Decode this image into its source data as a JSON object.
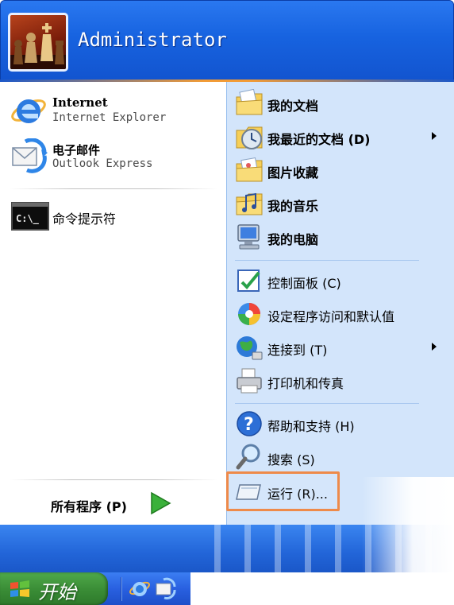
{
  "user": {
    "name": "Administrator",
    "avatar_icon": "chess-pieces-avatar"
  },
  "pinned": [
    {
      "title": "Internet",
      "subtitle": "Internet Explorer",
      "icon": "internet-explorer-icon"
    },
    {
      "title": "电子邮件",
      "subtitle": "Outlook Express",
      "icon": "outlook-express-icon"
    }
  ],
  "recent": [
    {
      "label": "命令提示符",
      "icon": "command-prompt-icon",
      "icon_text": "C:\\_"
    }
  ],
  "all_programs": {
    "label": "所有程序 (P)",
    "icon": "green-arrow-icon"
  },
  "places": [
    {
      "label": "我的文档",
      "bold": true,
      "icon": "my-documents-icon",
      "submenu": false
    },
    {
      "label": "我最近的文档 (D)",
      "bold": true,
      "icon": "recent-documents-icon",
      "submenu": true
    },
    {
      "label": "图片收藏",
      "bold": true,
      "icon": "my-pictures-icon",
      "submenu": false
    },
    {
      "label": "我的音乐",
      "bold": true,
      "icon": "my-music-icon",
      "submenu": false
    },
    {
      "label": "我的电脑",
      "bold": true,
      "icon": "my-computer-icon",
      "submenu": false
    }
  ],
  "settings": [
    {
      "label": "控制面板 (C)",
      "icon": "control-panel-icon",
      "submenu": false
    },
    {
      "label": "设定程序访问和默认值",
      "icon": "program-access-icon",
      "submenu": false
    },
    {
      "label": "连接到 (T)",
      "icon": "connect-to-icon",
      "submenu": true
    },
    {
      "label": "打印机和传真",
      "icon": "printers-fax-icon",
      "submenu": false
    }
  ],
  "help": [
    {
      "label": "帮助和支持 (H)",
      "icon": "help-icon",
      "submenu": false
    },
    {
      "label": "搜索 (S)",
      "icon": "search-icon",
      "submenu": false
    },
    {
      "label": "运行 (R)...",
      "icon": "run-icon",
      "submenu": false,
      "highlighted": true
    }
  ],
  "taskbar": {
    "start_label": "开始",
    "quick_launch": [
      "internet-explorer-icon",
      "outlook-express-icon"
    ]
  },
  "colors": {
    "header_blue": "#1763e0",
    "places_bg": "#d3e5fb",
    "accent_orange": "#f29b35",
    "highlight_orange": "#ee8a4a",
    "start_green": "#3b8e37"
  }
}
